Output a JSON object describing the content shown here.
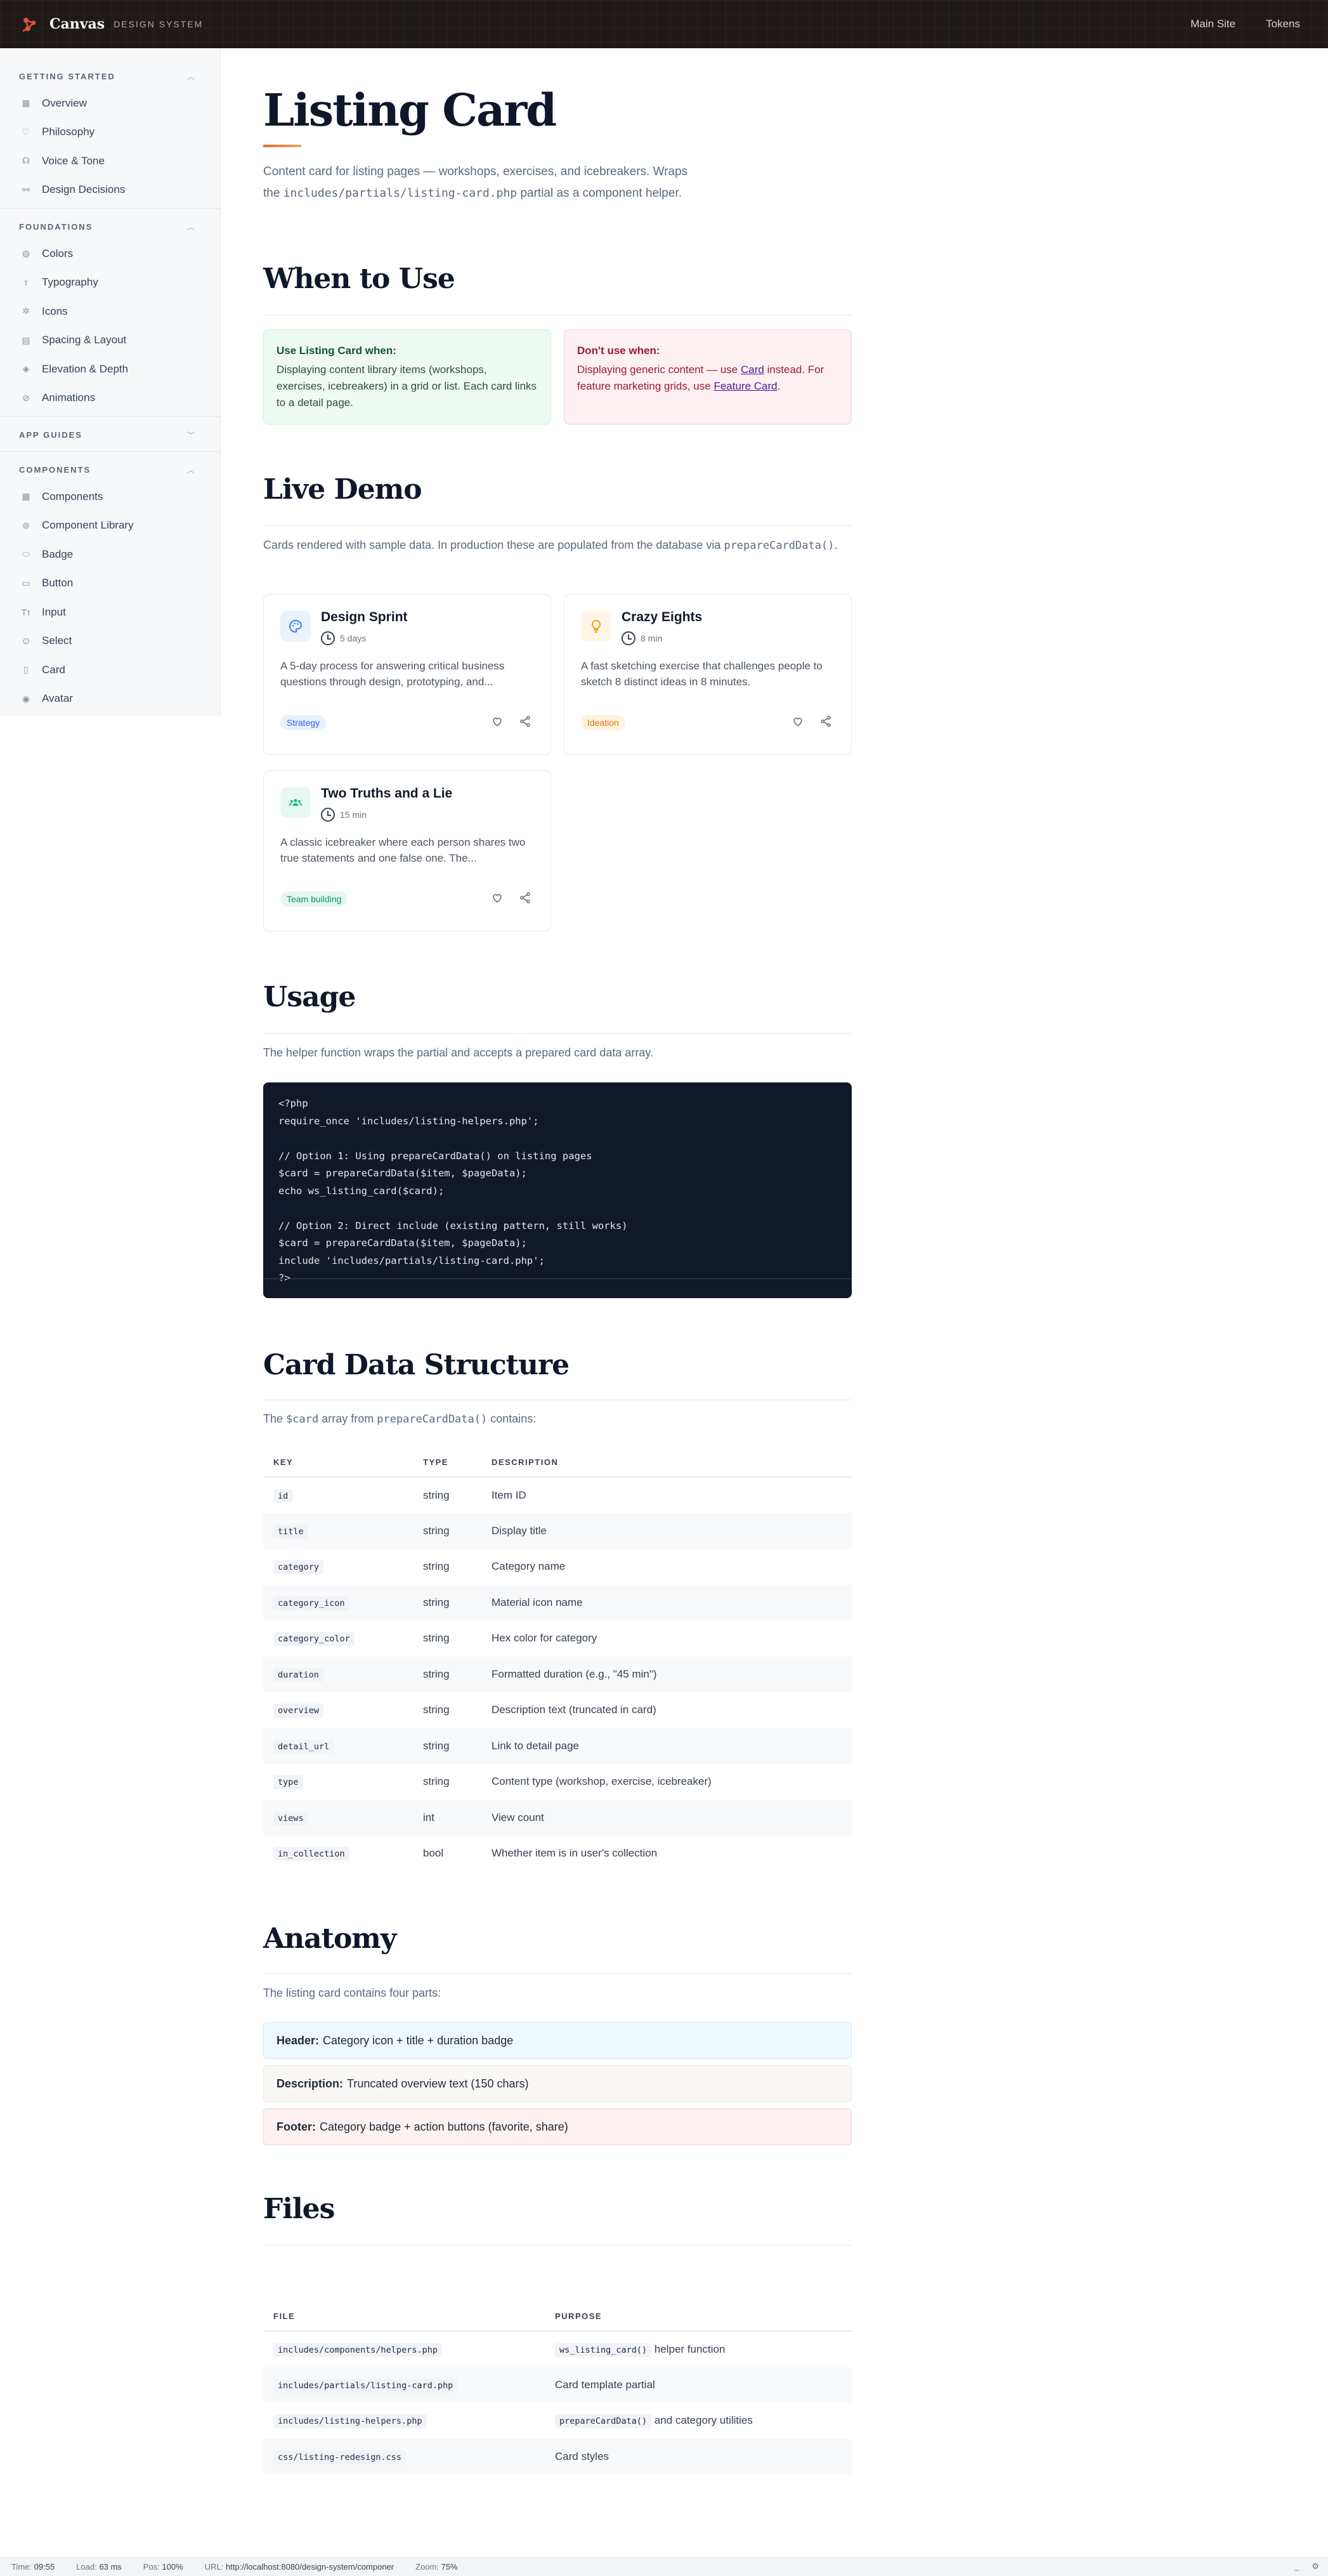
{
  "topbar": {
    "brand_name": "Canvas",
    "brand_sub": "DESIGN SYSTEM",
    "nav": [
      "Main Site",
      "Tokens"
    ],
    "accent": "#e0523a"
  },
  "sidebar": {
    "sections": [
      {
        "title": "GETTING STARTED",
        "items": [
          "Overview",
          "Philosophy",
          "Voice & Tone",
          "Design Decisions"
        ]
      },
      {
        "title": "FOUNDATIONS",
        "items": [
          "Colors",
          "Typography",
          "Icons",
          "Spacing & Layout",
          "Elevation & Depth",
          "Animations"
        ]
      },
      {
        "title": "APP GUIDES",
        "items": []
      },
      {
        "title": "COMPONENTS",
        "items": [
          "Components",
          "Component Library",
          "Badge",
          "Button",
          "Input",
          "Select",
          "Card",
          "Avatar"
        ]
      }
    ]
  },
  "page": {
    "title": "Listing Card",
    "intro_1": "Content card for listing pages — workshops, exercises, and icebreakers. Wraps the ",
    "intro_code": "includes/partials/listing-card.php",
    "intro_2": " partial as a component helper."
  },
  "when": {
    "heading": "When to Use",
    "do_title": "Use Listing Card when:",
    "do_text": "Displaying content library items (workshops, exercises, icebreakers) in a grid or list. Each card links to a detail page.",
    "dont_title": "Don't use when:",
    "dont_text_1": "Displaying generic content — use ",
    "dont_link_1": "Card",
    "dont_text_2": " instead. For feature marketing grids, use ",
    "dont_link_2": "Feature Card",
    "dont_text_3": "."
  },
  "demo": {
    "heading": "Live Demo",
    "lead_1": "Cards rendered with sample data. In production these are populated from the database via ",
    "lead_code": "prepareCardData()",
    "lead_2": ".",
    "cards": [
      {
        "title": "Design Sprint",
        "duration": "5 days",
        "desc": "A 5-day process for answering critical business questions through design, prototyping, and...",
        "badge": "Strategy",
        "icon": "palette-icon",
        "color": "#3b82f6"
      },
      {
        "title": "Crazy Eights",
        "duration": "8 min",
        "desc": "A fast sketching exercise that challenges people to sketch 8 distinct ideas in 8 minutes.",
        "badge": "Ideation",
        "icon": "lightbulb-icon",
        "color": "#f59e0b"
      },
      {
        "title": "Two Truths and a Lie",
        "duration": "15 min",
        "desc": "A classic icebreaker where each person shares two true statements and one false one. The...",
        "badge": "Team building",
        "icon": "group-icon",
        "color": "#10b981"
      }
    ]
  },
  "usage": {
    "heading": "Usage",
    "lead": "The helper function wraps the partial and accepts a prepared card data array.",
    "code": "<?php\nrequire_once 'includes/listing-helpers.php';\n\n// Option 1: Using prepareCardData() on listing pages\n$card = prepareCardData($item, $pageData);\necho ws_listing_card($card);\n\n// Option 2: Direct include (existing pattern, still works)\n$card = prepareCardData($item, $pageData);\ninclude 'includes/partials/listing-card.php';\n?>"
  },
  "structure": {
    "heading": "Card Data Structure",
    "lead_1": "The ",
    "lead_code_1": "$card",
    "lead_2": " array from ",
    "lead_code_2": "prepareCardData()",
    "lead_3": " contains:",
    "columns": [
      "KEY",
      "TYPE",
      "DESCRIPTION"
    ],
    "rows": [
      [
        "id",
        "string",
        "Item ID"
      ],
      [
        "title",
        "string",
        "Display title"
      ],
      [
        "category",
        "string",
        "Category name"
      ],
      [
        "category_icon",
        "string",
        "Material icon name"
      ],
      [
        "category_color",
        "string",
        "Hex color for category"
      ],
      [
        "duration",
        "string",
        "Formatted duration (e.g., \"45 min\")"
      ],
      [
        "overview",
        "string",
        "Description text (truncated in card)"
      ],
      [
        "detail_url",
        "string",
        "Link to detail page"
      ],
      [
        "type",
        "string",
        "Content type (workshop, exercise, icebreaker)"
      ],
      [
        "views",
        "int",
        "View count"
      ],
      [
        "in_collection",
        "bool",
        "Whether item is in user's collection"
      ]
    ]
  },
  "anatomy": {
    "heading": "Anatomy",
    "lead": "The listing card contains four parts:",
    "parts": [
      {
        "label": "Header:",
        "text": "Category icon + title + duration badge",
        "bg": "#eff8ff",
        "border": "#cfe6fb"
      },
      {
        "label": "Description:",
        "text": "Truncated overview text (150 chars)",
        "bg": "#faf8f5",
        "border": "#ece7df"
      },
      {
        "label": "Footer:",
        "text": "Category badge + action buttons (favorite, share)",
        "bg": "#fdf1f1",
        "border": "#f5d3d3"
      }
    ]
  },
  "files": {
    "heading": "Files",
    "columns": [
      "FILE",
      "PURPOSE"
    ],
    "rows": [
      {
        "file": "includes/components/helpers.php",
        "code": "ws_listing_card()",
        "purpose": " helper function"
      },
      {
        "file": "includes/partials/listing-card.php",
        "code": "",
        "purpose": "Card template partial"
      },
      {
        "file": "includes/listing-helpers.php",
        "code": "prepareCardData()",
        "purpose": " and category utilities"
      },
      {
        "file": "css/listing-redesign.css",
        "code": "",
        "purpose": "Card styles"
      }
    ]
  },
  "statusbar": {
    "time_label": "Time:",
    "time": "09:55",
    "load_label": "Load:",
    "load": "63 ms",
    "pos_label": "Pos:",
    "pos": "100%",
    "url_label": "URL:",
    "url": "http://localhost:8080/design-system/componer",
    "zoom_label": "Zoom:",
    "zoom": "75%"
  }
}
